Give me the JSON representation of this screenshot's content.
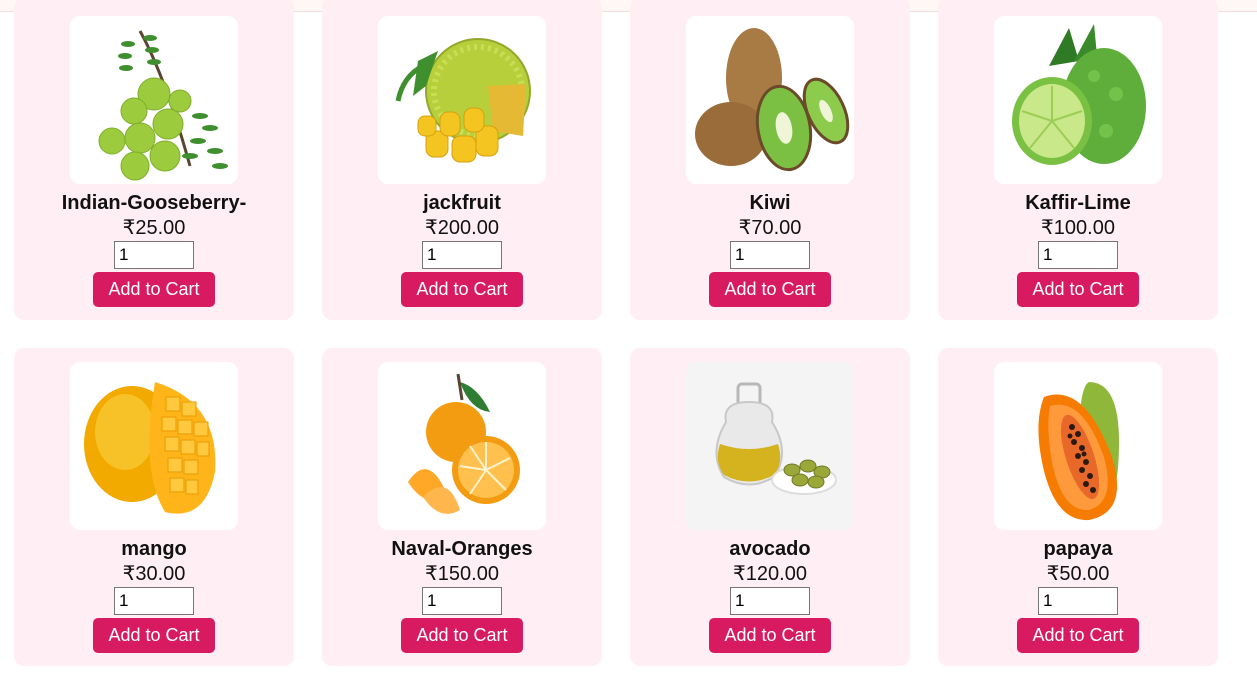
{
  "currency_symbol": "₹",
  "colors": {
    "card_bg": "#ffeef4",
    "button_bg": "#d81b60",
    "button_text": "#ffffff"
  },
  "add_to_cart_label": "Add to Cart",
  "products": [
    {
      "name": "Indian-Gooseberry-",
      "price": "₹25.00",
      "qty": "1",
      "image": "gooseberry-image"
    },
    {
      "name": "jackfruit",
      "price": "₹200.00",
      "qty": "1",
      "image": "jackfruit-image"
    },
    {
      "name": "Kiwi",
      "price": "₹70.00",
      "qty": "1",
      "image": "kiwi-image"
    },
    {
      "name": "Kaffir-Lime",
      "price": "₹100.00",
      "qty": "1",
      "image": "kaffir-lime-image"
    },
    {
      "name": "mango",
      "price": "₹30.00",
      "qty": "1",
      "image": "mango-image"
    },
    {
      "name": "Naval-Oranges",
      "price": "₹150.00",
      "qty": "1",
      "image": "orange-image"
    },
    {
      "name": "avocado",
      "price": "₹120.00",
      "qty": "1",
      "image": "olive-oil-image"
    },
    {
      "name": "papaya",
      "price": "₹50.00",
      "qty": "1",
      "image": "papaya-image"
    }
  ]
}
